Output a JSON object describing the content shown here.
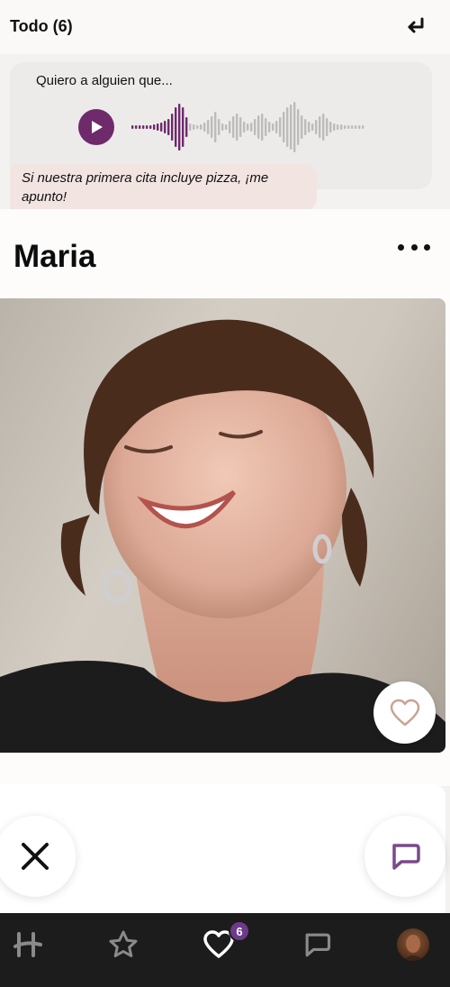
{
  "header": {
    "filter_title": "Todo (6)",
    "undo_icon": "undo-arrow-icon"
  },
  "voice_prompt": {
    "prompt_text": "Quiero a alguien que...",
    "play_icon": "play-icon",
    "accent_color": "#6e2a6b",
    "answer_text": "Si nuestra primera cita incluye pizza, ¡me apunto!"
  },
  "profile": {
    "name": "Maria",
    "more_icon": "more-dots-icon",
    "like_icon": "heart-outline-icon"
  },
  "actions": {
    "pass_icon": "close-x-icon",
    "message_icon": "chat-bubble-icon"
  },
  "bottom_nav": {
    "items": [
      {
        "icon": "hinge-logo-icon"
      },
      {
        "icon": "star-icon"
      },
      {
        "icon": "heart-likes-icon",
        "badge": "6"
      },
      {
        "icon": "chat-bubble-icon"
      },
      {
        "icon": "profile-avatar"
      }
    ],
    "badge_color": "#6e3a8a"
  }
}
